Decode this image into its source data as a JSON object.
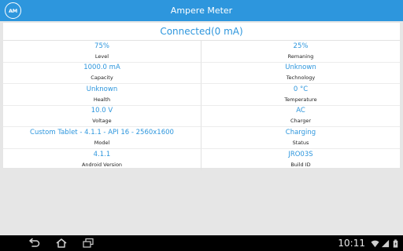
{
  "app": {
    "title": "Ampere Meter",
    "icon_text": "AM",
    "accent_color": "#2d96dd"
  },
  "status": {
    "header": "Connected(0 mA)"
  },
  "rows": [
    {
      "left": {
        "value": "75%",
        "label": "Level"
      },
      "right": {
        "value": "25%",
        "label": "Remaning"
      }
    },
    {
      "left": {
        "value": "1000.0 mA",
        "label": "Capacity"
      },
      "right": {
        "value": "Unknown",
        "label": "Technology"
      }
    },
    {
      "left": {
        "value": "Unknown",
        "label": "Health"
      },
      "right": {
        "value": "0 °C",
        "label": "Temperature"
      }
    },
    {
      "left": {
        "value": "10.0 V",
        "label": "Voltage"
      },
      "right": {
        "value": "AC",
        "label": "Charger"
      }
    },
    {
      "left": {
        "value": "Custom Tablet - 4.1.1 - API 16 - 2560x1600",
        "label": "Model"
      },
      "right": {
        "value": "Charging",
        "label": "Status"
      }
    },
    {
      "left": {
        "value": "4.1.1",
        "label": "Android Version"
      },
      "right": {
        "value": "JRO03S",
        "label": "Build ID"
      }
    }
  ],
  "navbar": {
    "buttons": [
      "back-icon",
      "home-icon",
      "recent-apps-icon"
    ],
    "clock": "10:11",
    "system_icons": [
      "wifi-icon",
      "signal-icon",
      "battery-charging-icon"
    ]
  }
}
